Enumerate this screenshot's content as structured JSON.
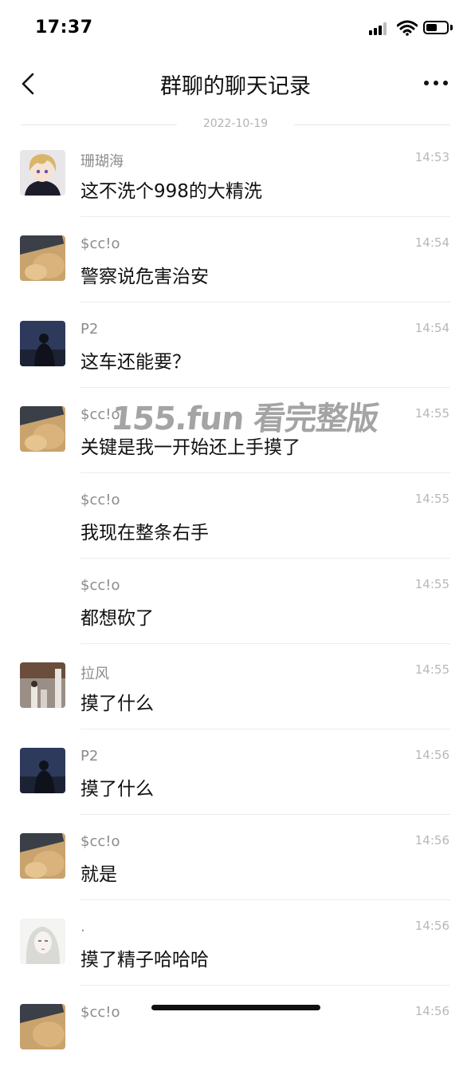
{
  "status_bar": {
    "time": "17:37"
  },
  "nav": {
    "title": "群聊的聊天记录"
  },
  "date_label": "2022-10-19",
  "watermark": "155.fun 看完整版",
  "messages": [
    {
      "sender": "珊瑚海",
      "text": "这不洗个998的大精洗",
      "time": "14:53",
      "avatar": "anime-boy-avatar"
    },
    {
      "sender": "$cc!o",
      "text": "警察说危害治安",
      "time": "14:54",
      "avatar": "cat-photo-avatar"
    },
    {
      "sender": "P2",
      "text": "这车还能要？",
      "time": "14:54",
      "avatar": "dark-figure-avatar"
    },
    {
      "sender": "$cc!o",
      "text": "关键是我一开始还上手摸了",
      "time": "14:55",
      "avatar": "cat-photo-avatar"
    },
    {
      "sender": "$cc!o",
      "text": "我现在整条右手",
      "time": "14:55",
      "avatar": ""
    },
    {
      "sender": "$cc!o",
      "text": "都想砍了",
      "time": "14:55",
      "avatar": ""
    },
    {
      "sender": "拉风",
      "text": "摸了什么",
      "time": "14:55",
      "avatar": "street-photo-avatar"
    },
    {
      "sender": "P2",
      "text": "摸了什么",
      "time": "14:56",
      "avatar": "dark-figure-avatar"
    },
    {
      "sender": "$cc!o",
      "text": "就是",
      "time": "14:56",
      "avatar": "cat-photo-avatar"
    },
    {
      "sender": ".",
      "text": "摸了精子哈哈哈",
      "time": "14:56",
      "avatar": "sketch-girl-avatar"
    },
    {
      "sender": "$cc!o",
      "text": "",
      "time": "14:56",
      "avatar": "cat-photo-avatar"
    }
  ]
}
